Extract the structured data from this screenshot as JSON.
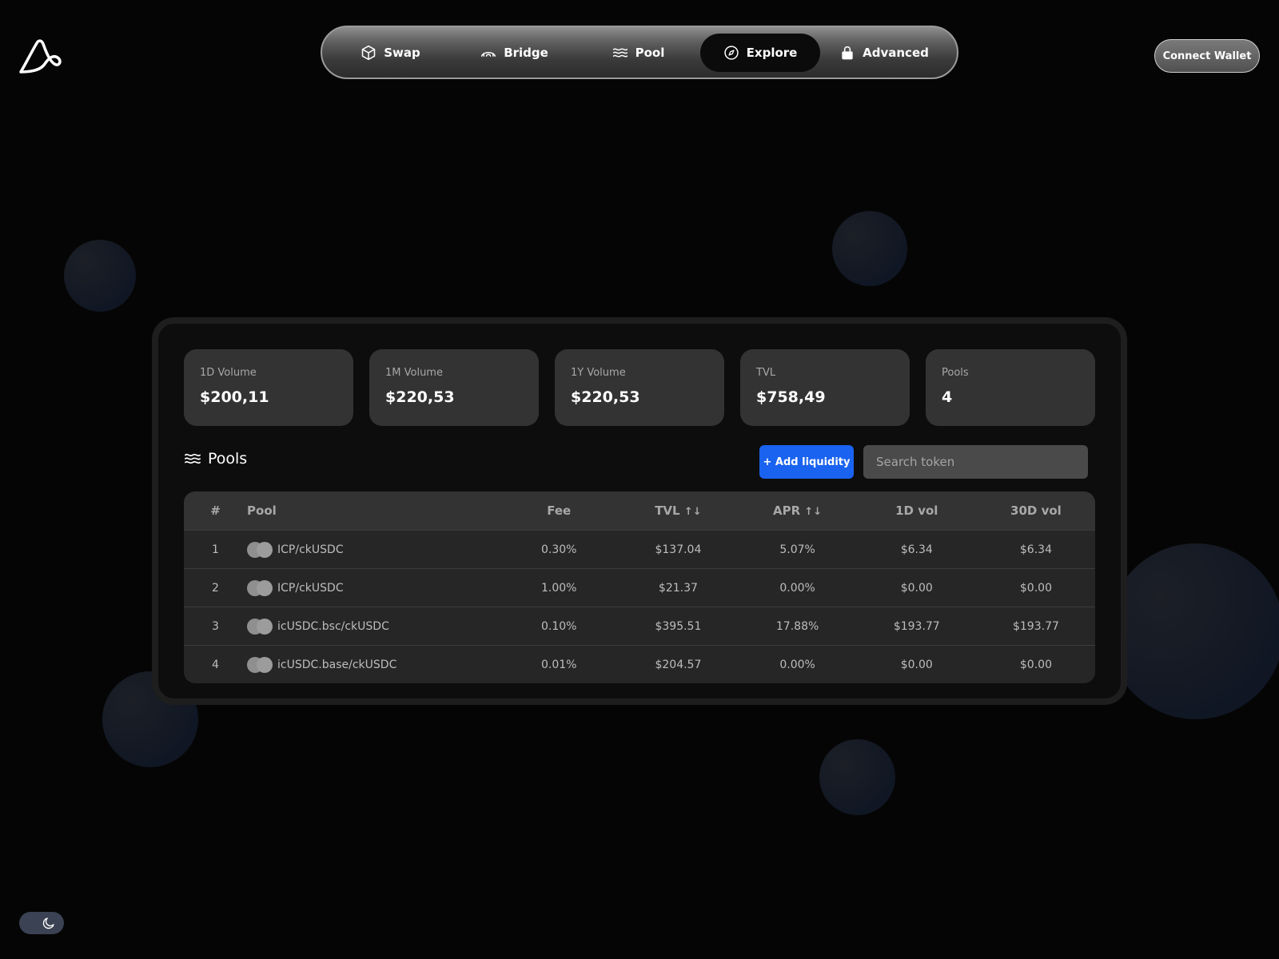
{
  "nav": {
    "items": [
      {
        "label": "Swap",
        "icon": "cube-icon"
      },
      {
        "label": "Bridge",
        "icon": "bridge-icon"
      },
      {
        "label": "Pool",
        "icon": "waves-icon"
      },
      {
        "label": "Explore",
        "icon": "compass-icon",
        "active": true
      },
      {
        "label": "Advanced",
        "icon": "lock-icon"
      }
    ]
  },
  "header": {
    "connect_label": "Connect Wallet"
  },
  "stats": [
    {
      "label": "1D Volume",
      "value": "$200,11"
    },
    {
      "label": "1M Volume",
      "value": "$220,53"
    },
    {
      "label": "1Y Volume",
      "value": "$220,53"
    },
    {
      "label": "TVL",
      "value": "$758,49"
    },
    {
      "label": "Pools",
      "value": "4"
    }
  ],
  "pools": {
    "title": "Pools",
    "add_label": "+ Add liquidity",
    "search_placeholder": "Search token",
    "columns": {
      "num": "#",
      "pool": "Pool",
      "fee": "Fee",
      "tvl": "TVL",
      "apr": "APR",
      "vol1d": "1D vol",
      "vol30d": "30D vol",
      "sort": "↑↓"
    },
    "rows": [
      {
        "num": "1",
        "pool": "ICP/ckUSDC",
        "fee": "0.30%",
        "tvl": "$137.04",
        "apr": "5.07%",
        "vol1d": "$6.34",
        "vol30d": "$6.34"
      },
      {
        "num": "2",
        "pool": "ICP/ckUSDC",
        "fee": "1.00%",
        "tvl": "$21.37",
        "apr": "0.00%",
        "vol1d": "$0.00",
        "vol30d": "$0.00"
      },
      {
        "num": "3",
        "pool": "icUSDC.bsc/ckUSDC",
        "fee": "0.10%",
        "tvl": "$395.51",
        "apr": "17.88%",
        "vol1d": "$193.77",
        "vol30d": "$193.77"
      },
      {
        "num": "4",
        "pool": "icUSDC.base/ckUSDC",
        "fee": "0.01%",
        "tvl": "$204.57",
        "apr": "0.00%",
        "vol1d": "$0.00",
        "vol30d": "$0.00"
      }
    ]
  },
  "colors": {
    "accent": "#1a63f0",
    "background": "#050505",
    "card": "#333333"
  }
}
